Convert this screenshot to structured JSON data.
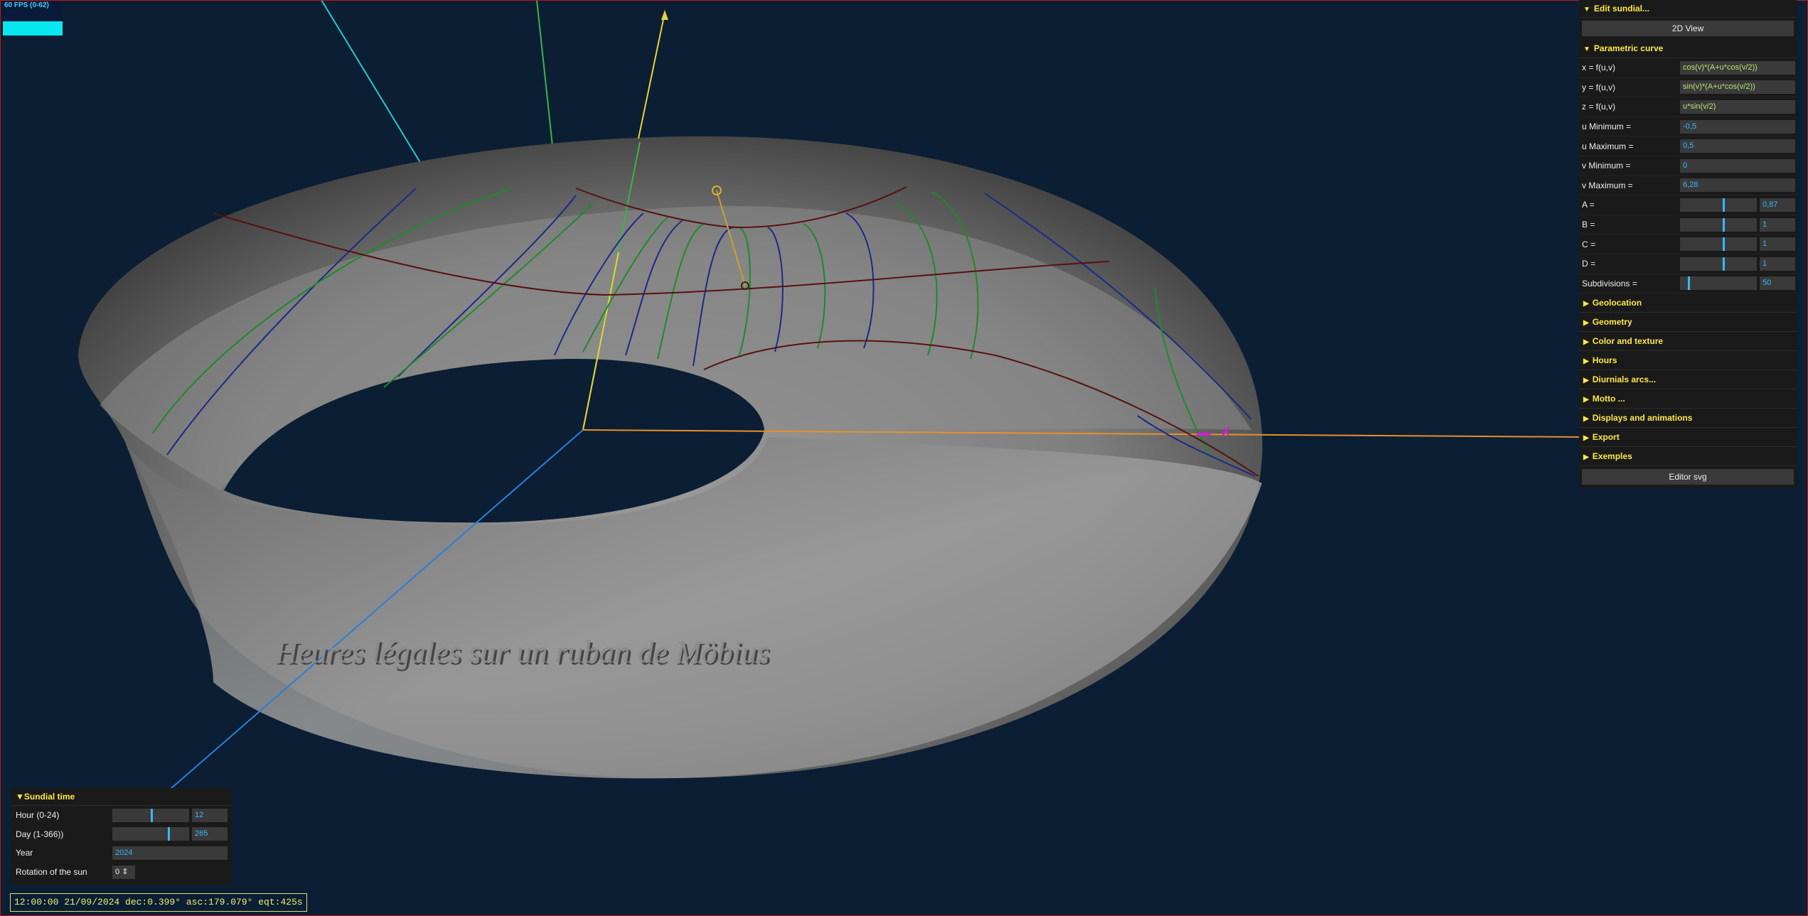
{
  "fps_label": "60 FPS (0-62)",
  "caption": "Heures légales sur un ruban de Möbius",
  "edit_panel": {
    "title": "Edit sundial...",
    "view_button": "2D View",
    "parametric_title": "Parametric curve",
    "rows": [
      {
        "label": "x = f(u,v)",
        "value": "cos(v)*(A+u*cos(v/2))"
      },
      {
        "label": "y = f(u,v)",
        "value": "sin(v)*(A+u*cos(v/2))"
      },
      {
        "label": "z = f(u,v)",
        "value": "u*sin(v/2)"
      },
      {
        "label": "u Minimum =",
        "value": "-0,5"
      },
      {
        "label": "u Maximum =",
        "value": "0,5"
      },
      {
        "label": "v Minimum =",
        "value": "0"
      },
      {
        "label": "v Maximum =",
        "value": "6,28"
      }
    ],
    "sliders": [
      {
        "label": "A =",
        "value": "0,87",
        "level": 0.56
      },
      {
        "label": "B =",
        "value": "1",
        "level": 0.56
      },
      {
        "label": "C =",
        "value": "1",
        "level": 0.56
      },
      {
        "label": "D =",
        "value": "1",
        "level": 0.56
      },
      {
        "label": "Subdivisions =",
        "value": "50",
        "level": 0.1
      }
    ],
    "folders": [
      "Geolocation",
      "Geometry",
      "Color and texture",
      "Hours",
      "Diurnials arcs...",
      "Motto ...",
      "Displays and animations",
      "Export",
      "Exemples"
    ],
    "svg_button": "Editor svg"
  },
  "sundial_time": {
    "title": "Sundial time",
    "hour_label": "Hour  (0-24)",
    "hour_value": "12",
    "hour_level": 0.5,
    "day_label": "Day (1-366))",
    "day_value": "265",
    "day_level": 0.72,
    "year_label": "Year",
    "year_value": "2024",
    "rotation_label": "Rotation of the sun",
    "rotation_value": "0"
  },
  "status_line": "12:00:00 21/09/2024 dec:0.399° asc:179.079° eqt:425s"
}
